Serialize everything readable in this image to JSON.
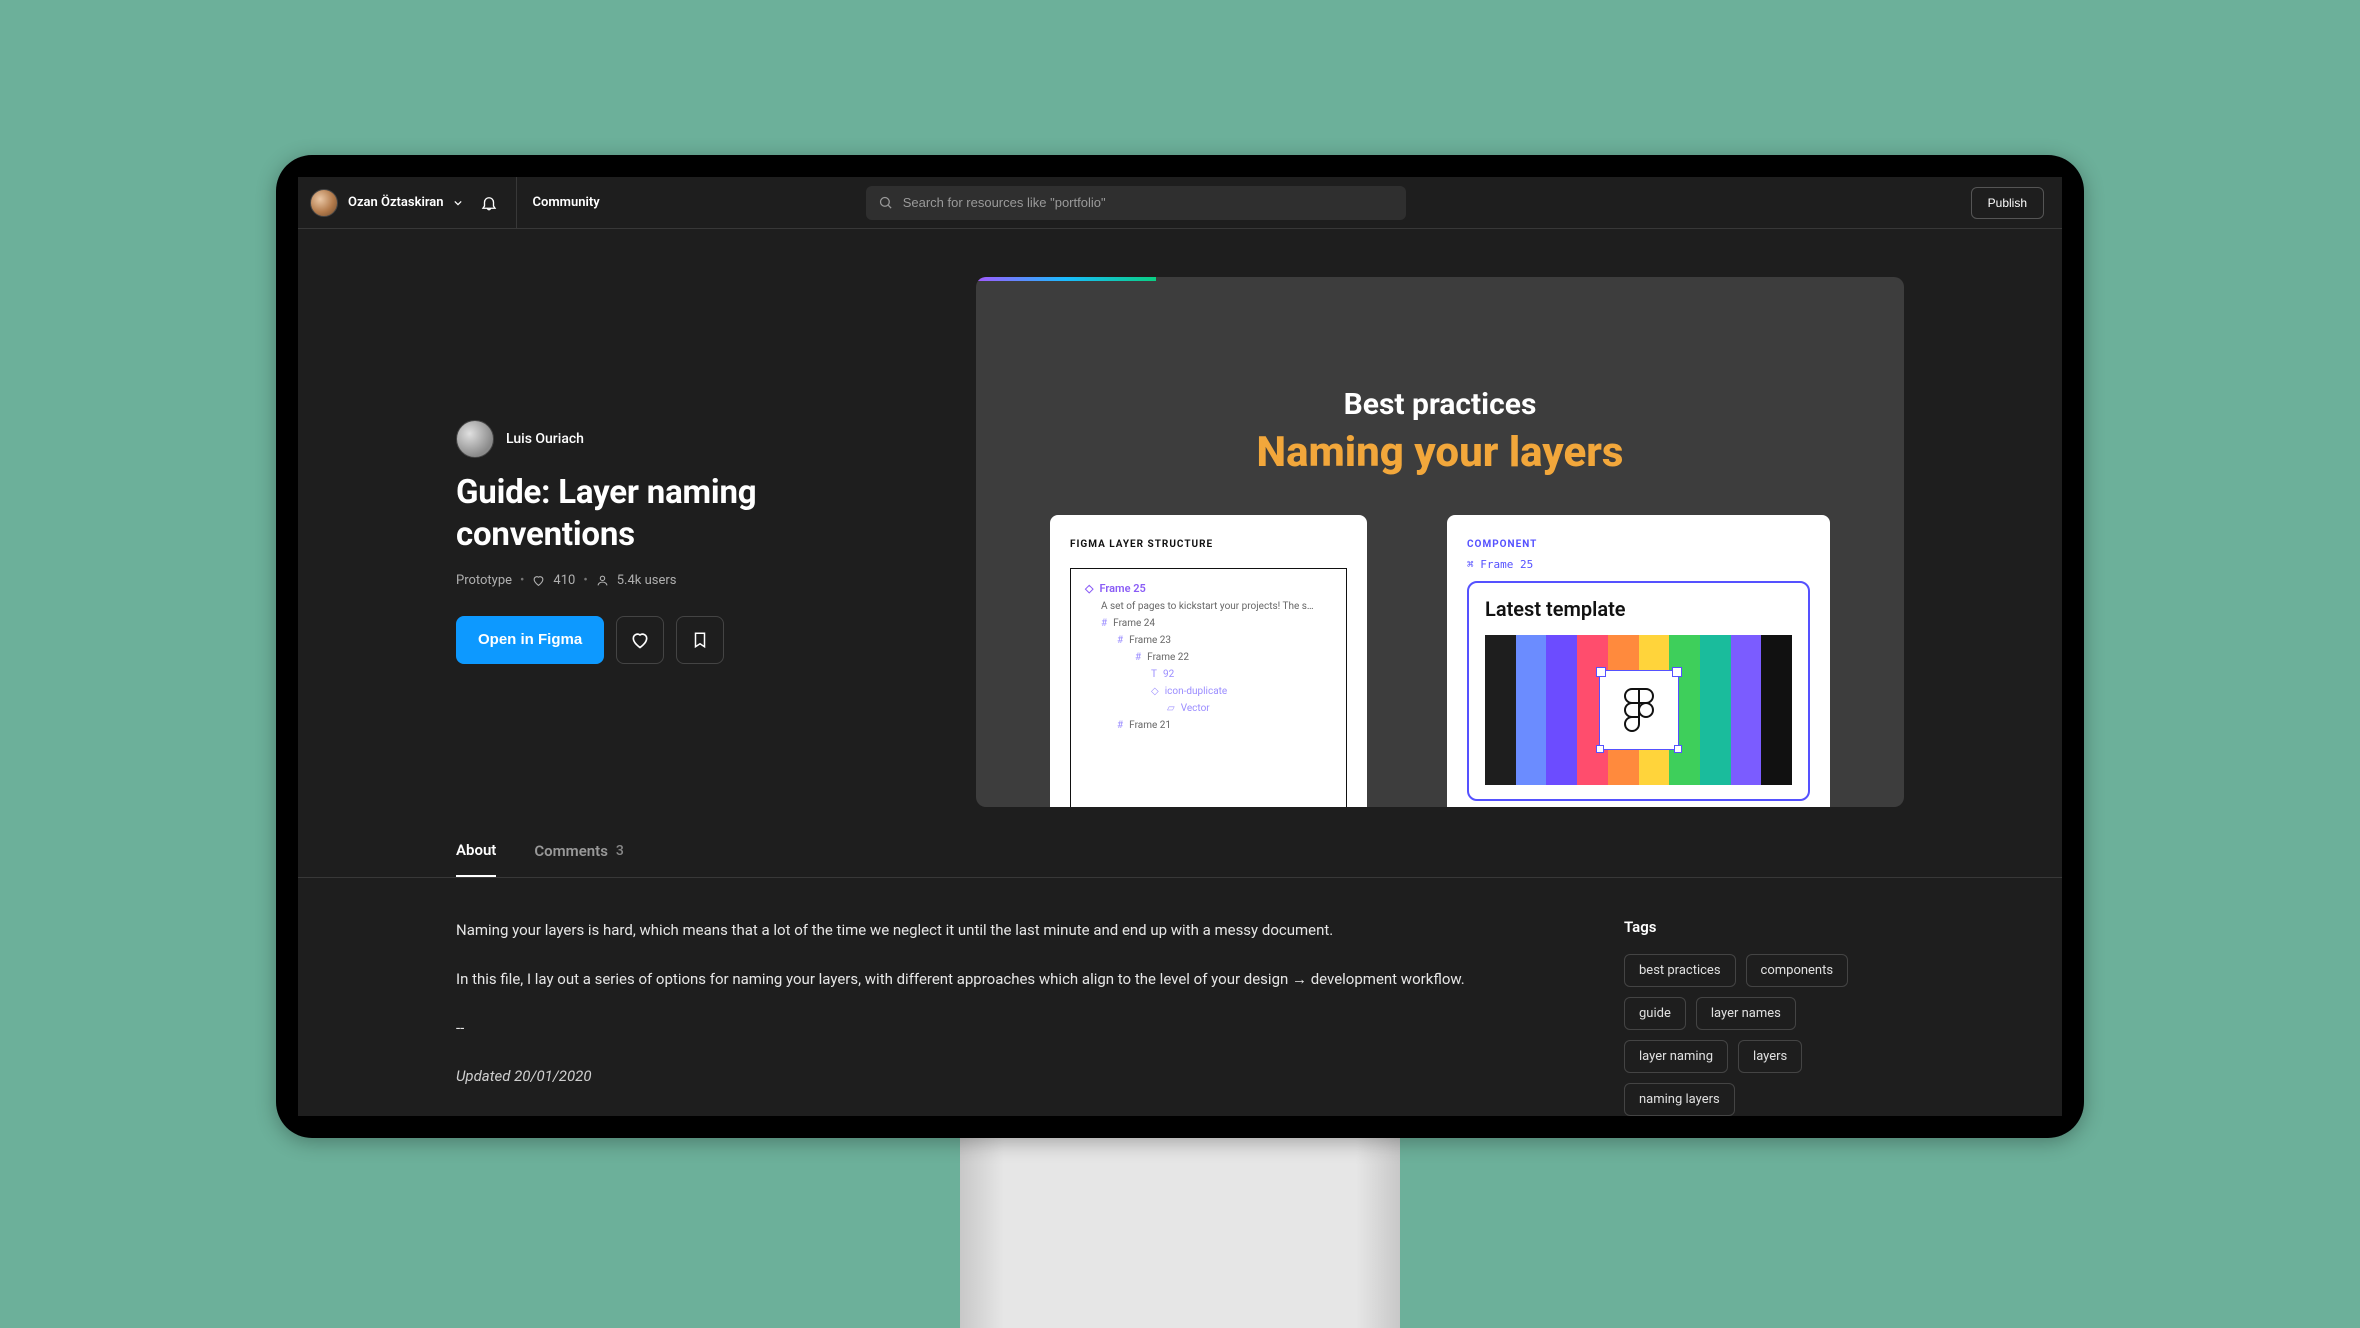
{
  "topbar": {
    "username": "Ozan Öztaskiran",
    "community_label": "Community",
    "search_placeholder": "Search for resources like \"portfolio\"",
    "publish_label": "Publish"
  },
  "hero": {
    "author_name": "Luis Ouriach",
    "title": "Guide: Layer naming conventions",
    "meta": {
      "type": "Prototype",
      "likes": "410",
      "users": "5.4k users"
    },
    "open_label": "Open in Figma",
    "preview": {
      "h1": "Best practices",
      "h2": "Naming your layers",
      "left_card_label": "FIGMA LAYER STRUCTURE",
      "right_card_label": "COMPONENT",
      "frame_ref": "⌘ Frame 25",
      "layers": [
        "Frame 25",
        "A set of pages to kickstart your projects! The s…",
        "Frame 24",
        "Frame 23",
        "Frame 22",
        "92",
        "icon-duplicate",
        "Vector",
        "Frame 21"
      ],
      "component_title": "Latest template"
    }
  },
  "tabs": {
    "about": "About",
    "comments": "Comments",
    "comments_count": "3"
  },
  "description": {
    "p1": "Naming your layers is hard, which means that a lot of the time we neglect it until the last minute and end up with a messy document.",
    "p2": "In this file, I lay out a series of options for naming your layers, with different approaches which align to the level of your design → development workflow.",
    "sep": "--",
    "updated_prefix": "Updated ",
    "updated_date": "20/01/2020"
  },
  "tags_section": {
    "title": "Tags",
    "items": [
      "best practices",
      "components",
      "guide",
      "layer names",
      "layer naming",
      "layers",
      "naming layers"
    ]
  }
}
